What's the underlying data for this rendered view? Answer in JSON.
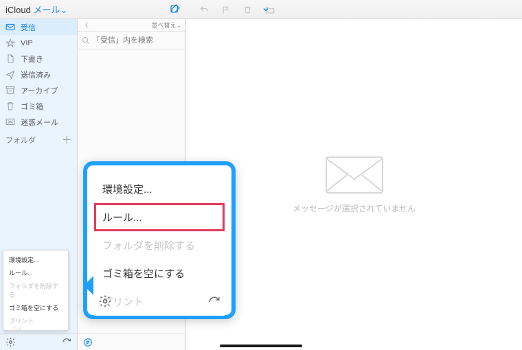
{
  "brand": {
    "icloud": "iCloud",
    "mail": "メール",
    "chevron": "⌄"
  },
  "toolbar": {
    "reply": "↩",
    "flag": "⚑",
    "trash": "🗑",
    "folder": "📁",
    "dropdown": "⌄"
  },
  "sidebar": {
    "items": [
      {
        "label": "受信"
      },
      {
        "label": "VIP"
      },
      {
        "label": "下書き"
      },
      {
        "label": "送信済み"
      },
      {
        "label": "アーカイブ"
      },
      {
        "label": "ゴミ箱"
      },
      {
        "label": "迷惑メール"
      }
    ],
    "folders_header": "フォルダ",
    "add": "＋"
  },
  "midcol": {
    "back": "〈",
    "sort_label": "並べ替え",
    "sort_chevron": "⌄",
    "search_placeholder": "「受信」内を検索"
  },
  "reader": {
    "empty_msg": "メッセージが選択されていません"
  },
  "popup": {
    "items": [
      {
        "label": "環境設定...",
        "disabled": false
      },
      {
        "label": "ルール...",
        "disabled": false,
        "selected": true
      },
      {
        "label": "フォルダを削除する",
        "disabled": true
      },
      {
        "label": "ゴミ箱を空にする",
        "disabled": false
      },
      {
        "label": "プリント",
        "disabled": true
      }
    ]
  }
}
